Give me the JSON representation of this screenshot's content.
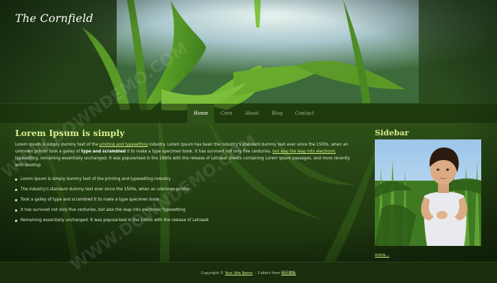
{
  "site": {
    "title": "The Cornfield"
  },
  "nav": {
    "items": [
      {
        "label": "Home",
        "active": true
      },
      {
        "label": "Corn"
      },
      {
        "label": "About"
      },
      {
        "label": "Blog"
      },
      {
        "label": "Contact"
      }
    ]
  },
  "main": {
    "heading": "Lorem Ipsum is simply",
    "intro": {
      "t1": "Lorem Ipsum is simply dummy text of the ",
      "link1": "printing and typesetting",
      "t2": " industry. Lorem Ipsum has been the industry's standard dummy text ever since the 1500s, when an unknown printer took a galley of ",
      "strong": "type and scrambled",
      "t3": " it to make a type specimen book. It has survived not only five centuries, ",
      "link2": "but also the leap into electronic",
      "t4": " typesetting, remaining essentially unchanged. It was popularised in the 1960s with the release of Letraset sheets containing Lorem Ipsum passages, and more recently with desktop"
    },
    "bullets": [
      "Lorem Ipsum is simply dummy text of the printing and typesetting industry",
      "The industry's standard dummy text ever since the 1500s, when an unknown printer",
      "Took a galley of type and scrambled it to make a type specimen book",
      "It has survived not only five centuries, but also the leap into electronic typesetting",
      "Remaining essentially unchanged. It was popularised in the 1960s with the release of Letraset"
    ]
  },
  "sidebar": {
    "heading": "Sidebar",
    "more": "more..."
  },
  "footer": {
    "copyright": "Copyright ©",
    "site_link": "Your Site Name",
    "separator": "|",
    "collect_label": "Collect from",
    "collect_link": "网页模板"
  },
  "watermark": {
    "text": "WWW.DOWNDEMO.COM"
  },
  "colors": {
    "accent": "#d8ee8c",
    "nav_active": "#2f5317",
    "footer_bg": "#1a2d0d"
  }
}
